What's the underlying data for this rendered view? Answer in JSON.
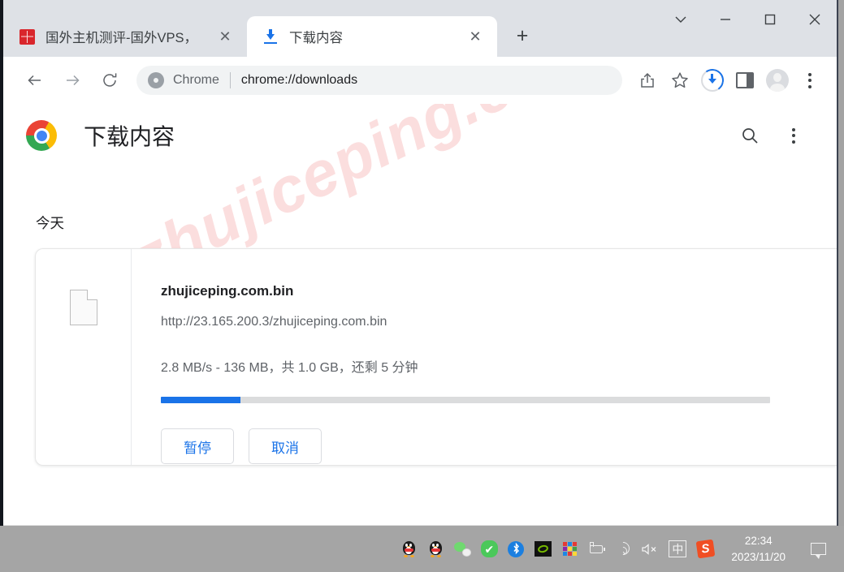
{
  "window": {
    "tabs": [
      {
        "title": "国外主机测评-国外VPS，",
        "favicon": "site-favicon-red",
        "active": false,
        "close_label": "✕"
      },
      {
        "title": "下载内容",
        "favicon": "download-icon",
        "active": true,
        "close_label": "✕"
      }
    ],
    "new_tab_label": "+",
    "controls": {
      "tab_search": "chevron-down-icon",
      "minimize": "minimize-icon",
      "maximize": "maximize-icon",
      "close": "close-icon"
    }
  },
  "toolbar": {
    "back": "back-arrow-icon",
    "forward": "forward-arrow-icon",
    "reload": "reload-icon",
    "omnibox": {
      "scheme_label": "Chrome",
      "url": "chrome://downloads",
      "logo": "chrome-logo-icon"
    },
    "share": "share-icon",
    "bookmark": "star-icon",
    "download_progress": "download-progress-icon",
    "side_panel": "side-panel-icon",
    "profile": "avatar-icon",
    "menu": "kebab-menu-icon"
  },
  "page": {
    "logo": "chrome-logo-icon",
    "title": "下载内容",
    "search_icon": "search-icon",
    "menu_icon": "kebab-menu-icon",
    "watermark": "zhujiceping.com",
    "section_label": "今天",
    "download": {
      "file_icon": "generic-file-icon",
      "file_name": "zhujiceping.com.bin",
      "file_url": "http://23.165.200.3/zhujiceping.com.bin",
      "status": "2.8 MB/s - 136 MB，共 1.0 GB，还剩 5 分钟",
      "speed": "2.8 MB/s",
      "downloaded": "136 MB",
      "total_size": "1.0 GB",
      "time_remaining": "5 分钟",
      "progress_percent": 13,
      "progress_color": "#1a73e8",
      "buttons": [
        {
          "label": "暂停",
          "name": "pause-button"
        },
        {
          "label": "取消",
          "name": "cancel-button"
        }
      ]
    }
  },
  "taskbar": {
    "tray_icons": [
      {
        "name": "qq-icon-1",
        "type": "qq"
      },
      {
        "name": "qq-icon-2",
        "type": "qq"
      },
      {
        "name": "wechat-icon",
        "type": "wechat"
      },
      {
        "name": "security-check-icon",
        "type": "check",
        "glyph": "✔"
      },
      {
        "name": "bluetooth-icon",
        "type": "bluetooth",
        "glyph": "✛"
      },
      {
        "name": "nvidia-icon",
        "type": "nvidia"
      },
      {
        "name": "color-grid-icon",
        "type": "grid"
      },
      {
        "name": "battery-icon",
        "type": "battery"
      },
      {
        "name": "wifi-icon",
        "type": "wifi"
      },
      {
        "name": "volume-mute-icon",
        "type": "mute"
      },
      {
        "name": "ime-icon",
        "type": "ime",
        "glyph": "中"
      },
      {
        "name": "sogou-icon",
        "type": "sogou",
        "glyph": "S"
      }
    ],
    "clock_time": "22:34",
    "clock_date": "2023/11/20",
    "notification_icon": "notification-icon"
  },
  "colors": {
    "accent_blue": "#1a73e8",
    "tabstrip_bg": "#dee1e6",
    "taskbar_bg": "#a5a5a5",
    "watermark": "#fbdede"
  }
}
